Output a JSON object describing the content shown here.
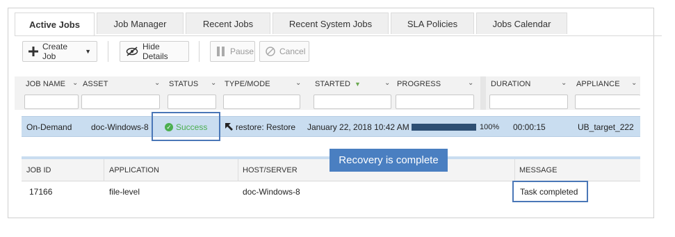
{
  "tabs": [
    {
      "label": "Active Jobs",
      "active": true
    },
    {
      "label": "Job Manager",
      "active": false
    },
    {
      "label": "Recent Jobs",
      "active": false
    },
    {
      "label": "Recent System Jobs",
      "active": false
    },
    {
      "label": "SLA Policies",
      "active": false
    },
    {
      "label": "Jobs Calendar",
      "active": false
    }
  ],
  "toolbar": {
    "create_job": "Create Job",
    "hide_details": "Hide Details",
    "pause": "Pause",
    "cancel": "Cancel"
  },
  "columns": [
    "JOB NAME",
    "ASSET",
    "STATUS",
    "TYPE/MODE",
    "STARTED",
    "PROGRESS",
    "DURATION",
    "APPLIANCE"
  ],
  "job_row": {
    "job_name": "On-Demand",
    "asset": "doc-Windows-8",
    "status": "Success",
    "type_mode": "restore: Restore",
    "started": "January 22, 2018 10:42 AM",
    "progress": 100,
    "progress_label": "100%",
    "duration": "00:00:15",
    "appliance": "UB_target_222"
  },
  "detail": {
    "columns": [
      "JOB ID",
      "APPLICATION",
      "HOST/SERVER",
      "MESSAGE"
    ],
    "row": {
      "job_id": "17166",
      "application": "file-level",
      "host": "doc-Windows-8",
      "message": "Task completed"
    }
  },
  "callout": "Recovery is complete",
  "colors": {
    "selected_row": "#c9ddf0",
    "progress": "#2e4f73",
    "success": "#4caf50",
    "highlight": "#4a77b7",
    "callout": "#4a7fc1"
  }
}
